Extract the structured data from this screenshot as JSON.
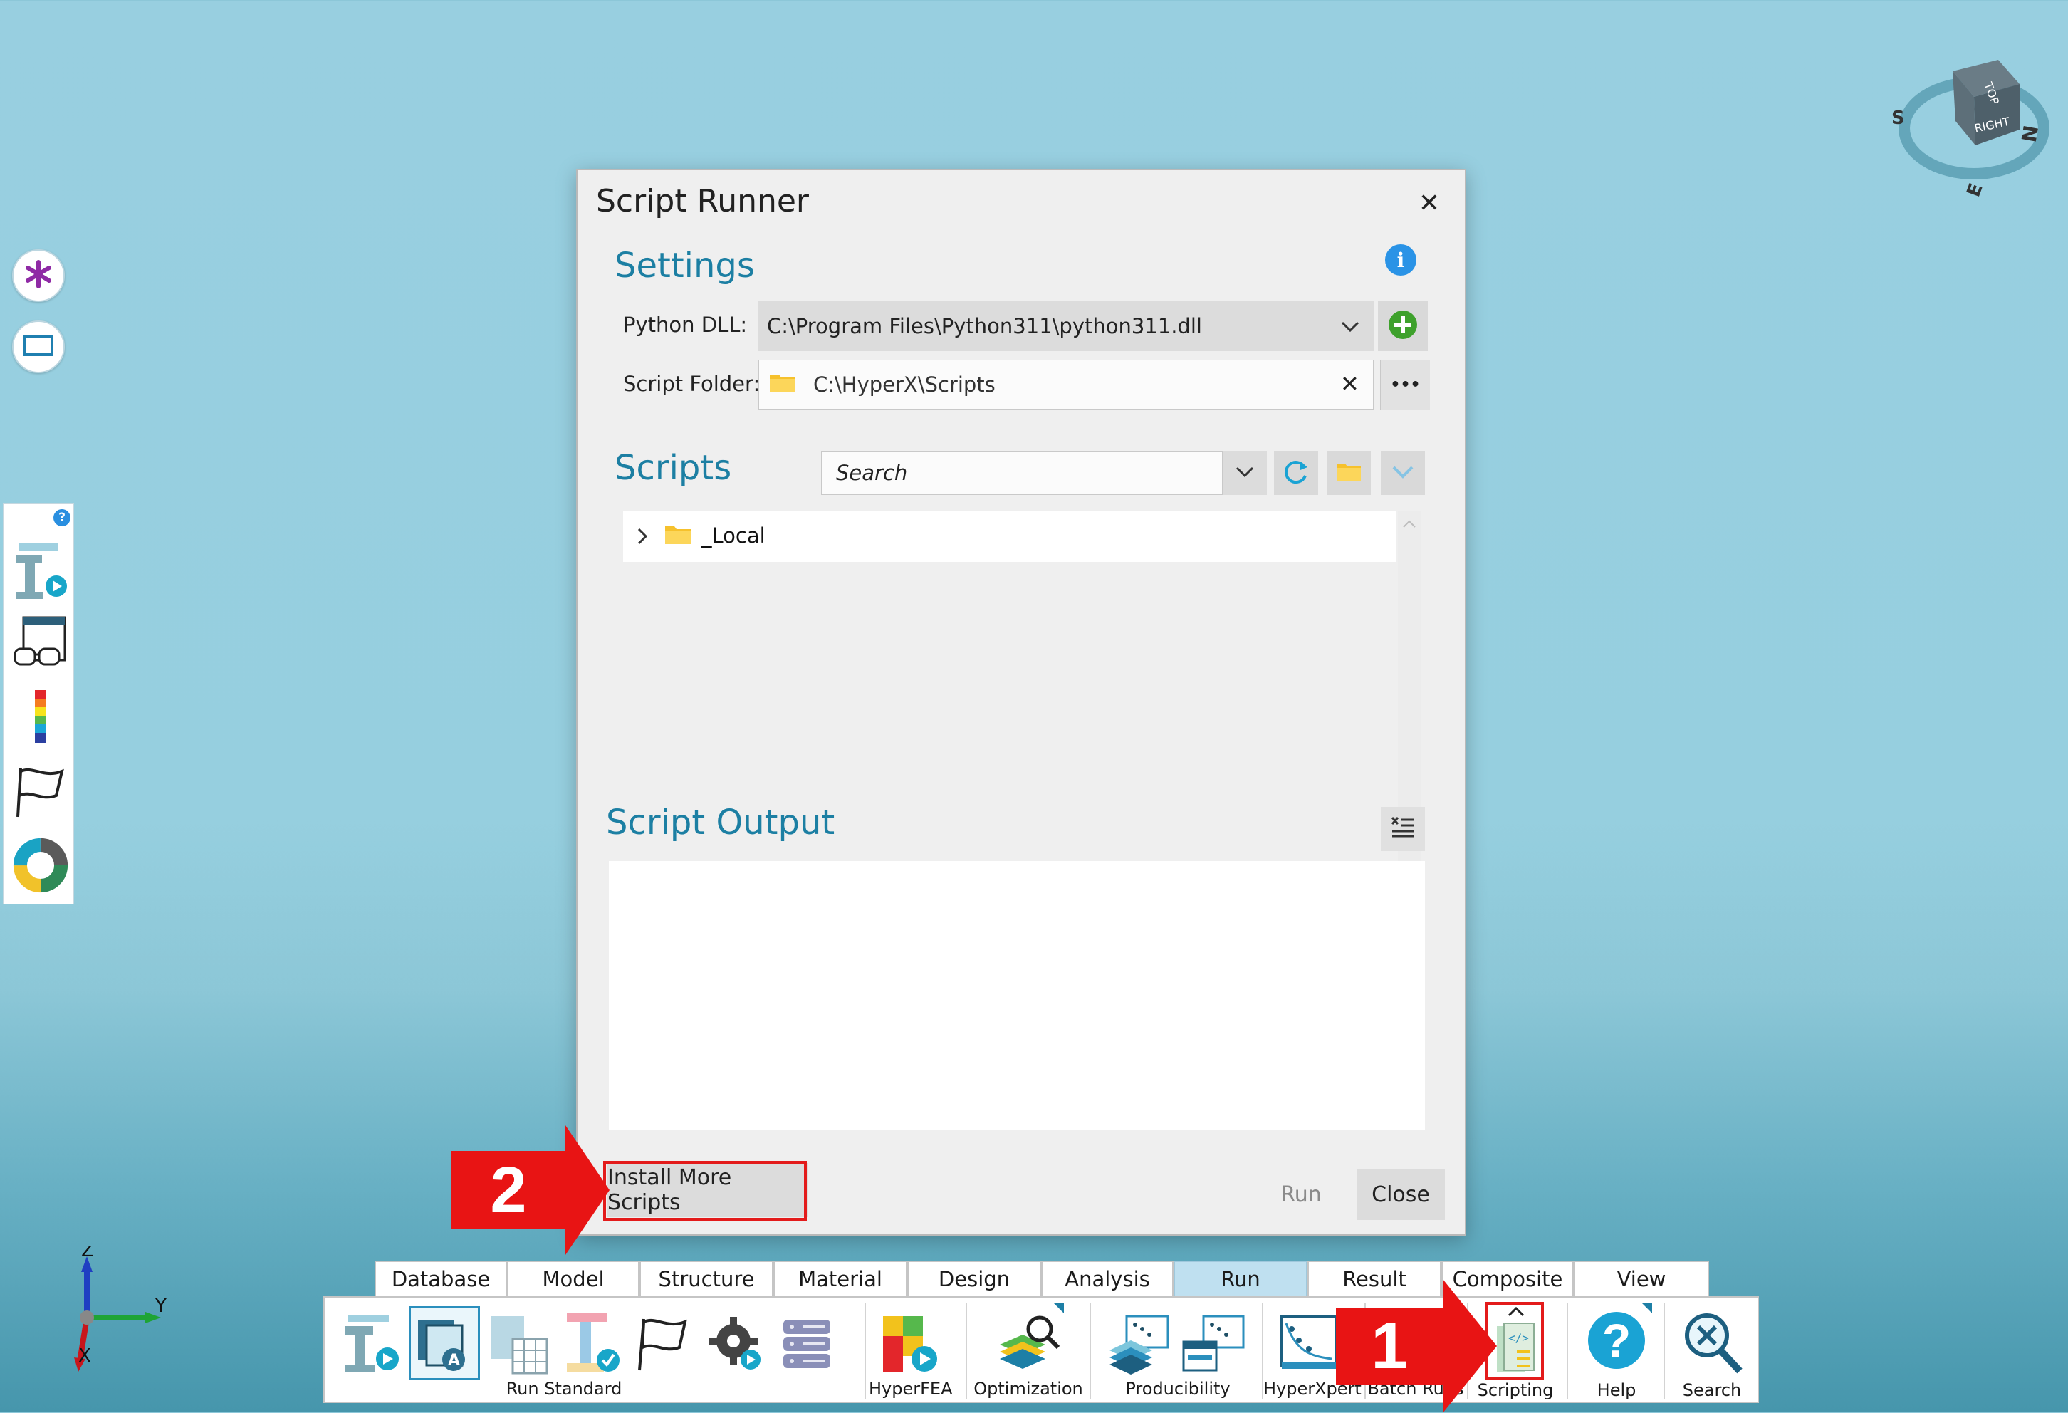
{
  "viewcube": {
    "top": "TOP",
    "right": "RIGHT",
    "compass_s": "S",
    "compass_n": "N",
    "compass_e": "E"
  },
  "axes": {
    "z": "Z",
    "y": "Y",
    "x": "X"
  },
  "side_panel": {
    "help": "?"
  },
  "dialog": {
    "title": "Script Runner",
    "close_glyph": "✕",
    "settings": {
      "heading": "Settings",
      "python_dll_label": "Python DLL:",
      "python_dll_value": "C:\\Program Files\\Python311\\python311.dll",
      "script_folder_label": "Script Folder:",
      "script_folder_value": "C:\\HyperX\\Scripts",
      "browse_glyph": "•••",
      "clear_glyph": "✕"
    },
    "scripts": {
      "heading": "Scripts",
      "search_placeholder": "Search",
      "tree": [
        {
          "label": "_Local"
        }
      ]
    },
    "output": {
      "heading": "Script Output"
    },
    "buttons": {
      "install": "Install More Scripts",
      "run": "Run",
      "close": "Close"
    }
  },
  "annotations": {
    "step1": "1",
    "step2": "2"
  },
  "ribbon": {
    "tabs": [
      "Database",
      "Model",
      "Structure",
      "Material",
      "Design",
      "Analysis",
      "Run",
      "Result",
      "Composite",
      "View"
    ],
    "active_tab": "Run",
    "groups": {
      "run_standard": "Run Standard",
      "hyperfea": "HyperFEA",
      "optimization": "Optimization",
      "producibility": "Producibility",
      "hyperxpert": "HyperXpert",
      "batch_runs": "Batch Runs",
      "scripting": "Scripting",
      "help": "Help",
      "search": "Search"
    },
    "help_glyph": "?"
  },
  "colors": {
    "accent": "#1c7fa3",
    "callout": "#e81414",
    "active_tab": "#bfe0f0"
  }
}
